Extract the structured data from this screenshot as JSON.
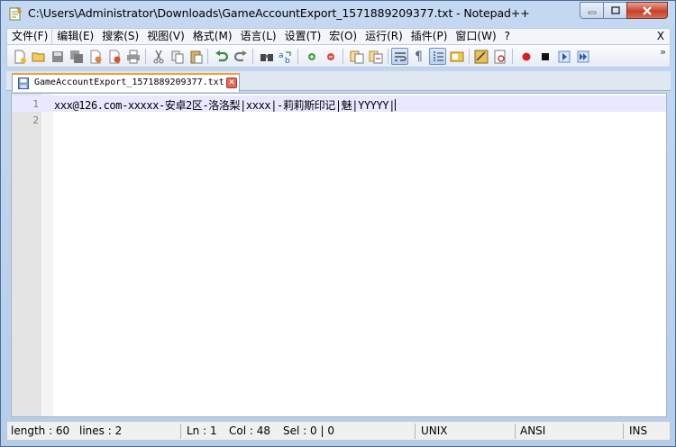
{
  "window": {
    "title": "C:\\Users\\Administrator\\Downloads\\GameAccountExport_1571889209377.txt - Notepad++"
  },
  "menubar": {
    "items": [
      "文件(F)",
      "编辑(E)",
      "搜索(S)",
      "视图(V)",
      "格式(M)",
      "语言(L)",
      "设置(T)",
      "宏(O)",
      "运行(R)",
      "插件(P)",
      "窗口(W)",
      "?"
    ],
    "close_label": "X"
  },
  "toolbar": {
    "icons": [
      "new-file-icon",
      "open-file-icon",
      "save-icon",
      "save-all-icon",
      "close-icon",
      "close-all-icon",
      "print-icon",
      "cut-icon",
      "copy-icon",
      "paste-icon",
      "undo-icon",
      "redo-icon",
      "find-icon",
      "replace-icon",
      "zoom-in-icon",
      "zoom-out-icon",
      "sync-vertical-icon",
      "sync-horizontal-icon",
      "word-wrap-icon",
      "show-all-characters-icon",
      "indent-guide-icon",
      "document-map-icon",
      "function-list-icon",
      "folder-as-workspace-icon",
      "record-macro-icon",
      "stop-record-icon",
      "play-macro-icon",
      "run-macro-multiple-icon"
    ],
    "overflow_label": "»"
  },
  "tabs": [
    {
      "label": "GameAccountExport_1571889209377.txt",
      "active": true
    }
  ],
  "editor": {
    "lines": [
      {
        "number": "1",
        "text": "xxx@126.com-xxxxx-安卓2区-洛洛梨|xxxx|-莉莉斯印记|魅|YYYYY|"
      },
      {
        "number": "2",
        "text": ""
      }
    ]
  },
  "statusbar": {
    "length": "length : 60",
    "lines": "lines : 2",
    "ln": "Ln : 1",
    "col": "Col : 48",
    "sel": "Sel : 0 | 0",
    "eol": "UNIX",
    "encoding": "ANSI",
    "mode": "INS"
  },
  "colors": {
    "current_line": "#e8e8ff",
    "tab_accent": "#f2a035",
    "close_button": "#c7412a"
  }
}
